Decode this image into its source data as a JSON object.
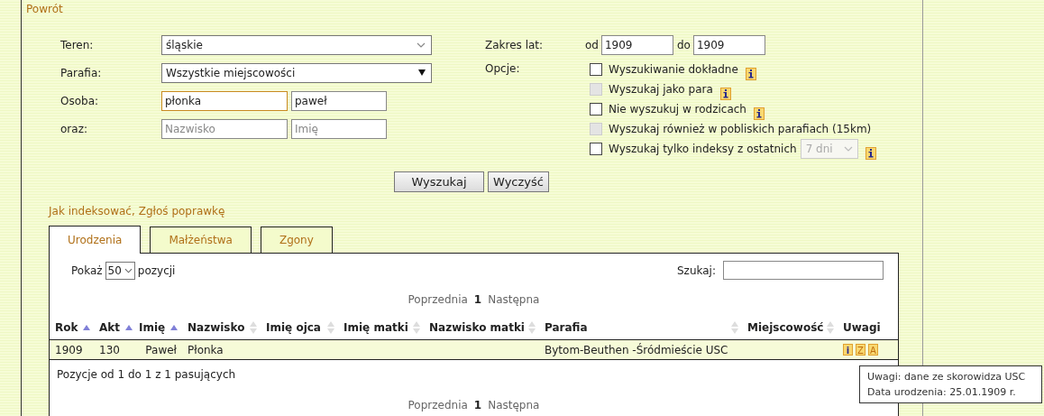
{
  "back_link": "Powrót",
  "form": {
    "rows": [
      {
        "label": "Teren:",
        "kind": "select",
        "value": "śląskie"
      },
      {
        "label": "Parafia:",
        "kind": "dropdown",
        "value": "Wszystkie miejscowości"
      },
      {
        "label": "Osoba:",
        "kind": "names",
        "surname": {
          "value": "płonka",
          "focused": true
        },
        "first_name": {
          "value": "paweł",
          "focused": false
        }
      },
      {
        "label": "oraz:",
        "kind": "names",
        "surname": {
          "placeholder": "Nazwisko",
          "focused": false
        },
        "first_name": {
          "placeholder": "Imię",
          "focused": false
        }
      }
    ],
    "year_range": {
      "label": "Zakres lat:",
      "from_label": "od",
      "from": "1909",
      "to_label": "do",
      "to": "1909"
    },
    "options": {
      "label": "Opcje:",
      "items": [
        {
          "label": "Wyszukiwanie dokładne",
          "checked": false,
          "disabled": false
        },
        {
          "label": "Wyszukaj jako para",
          "checked": false,
          "disabled": true
        },
        {
          "label": "Nie wyszukuj w rodzicach",
          "checked": false,
          "disabled": false
        },
        {
          "label": "Wyszukaj również w pobliskich parafiach (15km)",
          "checked": false,
          "disabled": true
        },
        {
          "label": "Wyszukaj tylko indeksy z ostatnich",
          "checked": false,
          "disabled": false,
          "period": "7 dni"
        }
      ]
    }
  },
  "buttons": [
    "Wyszukaj",
    "Wyczyść"
  ],
  "links": {
    "items": [
      "Jak indeksować",
      "Zgłoś poprawkę"
    ],
    "separator": ","
  },
  "tabs": [
    {
      "label": "Urodzenia",
      "selected": true
    },
    {
      "label": "Małżeństwa",
      "selected": false
    },
    {
      "label": "Zgony",
      "selected": false
    }
  ],
  "table_panel": {
    "length": {
      "before": "Pokaż",
      "value": "50",
      "after": "pozycji"
    },
    "search": {
      "label": "Szukaj:"
    },
    "pagination_top": {
      "prev": "Poprzednia",
      "page": "1",
      "next": "Następna"
    },
    "columns": [
      {
        "label": "Rok",
        "sorted": true
      },
      {
        "label": "Akt",
        "sorted": true
      },
      {
        "label": "Imię",
        "sorted": true
      },
      {
        "label": "Nazwisko",
        "sorted": false
      },
      {
        "label": "Imię ojca",
        "sorted": false
      },
      {
        "label": "Imię matki",
        "sorted": false
      },
      {
        "label": "Nazwisko matki",
        "sorted": false
      },
      {
        "label": "Parafia",
        "sorted": false
      },
      {
        "label": "Miejscowość",
        "sorted": false
      },
      {
        "label": "Uwagi"
      }
    ],
    "rows": [
      {
        "cells": [
          "1909",
          "130",
          "Paweł",
          "Płonka",
          "",
          "",
          "",
          "Bytom-Beuthen -Śródmieście USC",
          ""
        ],
        "notes": [
          {
            "kind": "info",
            "text": "i"
          },
          {
            "kind": "letter",
            "text": "Z"
          },
          {
            "kind": "letter",
            "text": "A"
          }
        ]
      }
    ],
    "info": "Pozycje od 1 do 1 z 1 pasujących",
    "pagination_bottom": {
      "prev": "Poprzednia",
      "page": "1",
      "next": "Następna"
    }
  },
  "tooltip": {
    "lines": [
      "Uwagi: dane ze skorowidza USC",
      "Data urodzenia: 25.01.1909 r."
    ]
  }
}
